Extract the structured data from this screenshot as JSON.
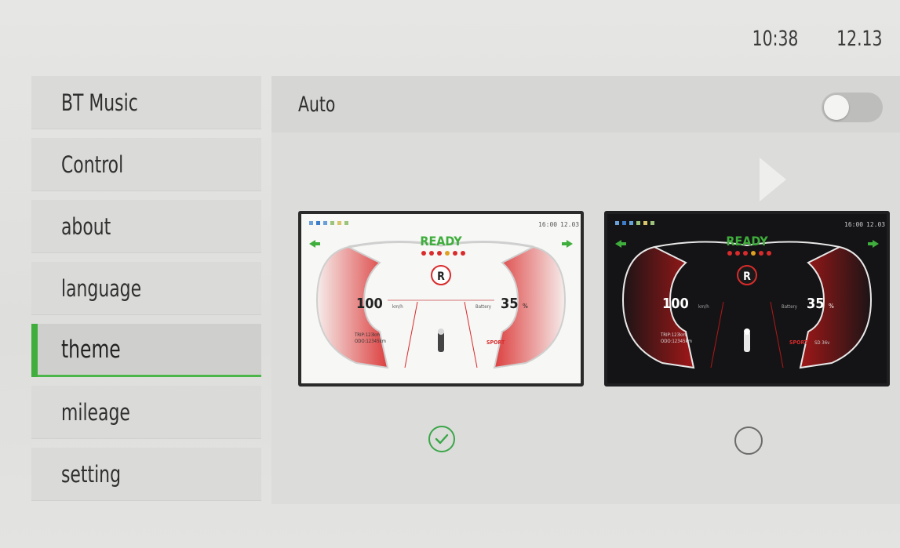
{
  "status": {
    "time": "10:38",
    "date": "12.13"
  },
  "sidebar": {
    "items": [
      {
        "label": "BT Music"
      },
      {
        "label": "Control"
      },
      {
        "label": "about"
      },
      {
        "label": "language"
      },
      {
        "label": "theme",
        "active": true
      },
      {
        "label": "mileage"
      },
      {
        "label": "setting"
      }
    ]
  },
  "theme_panel": {
    "auto_label": "Auto",
    "auto_enabled": false,
    "themes": [
      {
        "name": "light",
        "selected": true,
        "preview": {
          "time": "16:00",
          "date": "12.03",
          "ready": "READY",
          "gear": "R",
          "speed": "100",
          "speed_unit": "km/h",
          "battery_label": "Battery",
          "battery": "35",
          "battery_unit": "%",
          "trip": "TRIP:123km",
          "odo": "ODO:12345km",
          "mode": "SPORT"
        }
      },
      {
        "name": "dark",
        "selected": false,
        "preview": {
          "time": "16:00",
          "date": "12.03",
          "ready": "READY",
          "gear": "R",
          "speed": "100",
          "speed_unit": "km/h",
          "battery_label": "Battery",
          "battery": "35",
          "battery_unit": "%",
          "trip": "TRIP:123km",
          "odo": "ODO:12345km",
          "mode": "SPORT",
          "mode_extra": "SD 36v"
        }
      }
    ]
  },
  "colors": {
    "accent": "#3fae3c",
    "ready_green": "#3fae3c",
    "gauge_red": "#d92b2b"
  }
}
